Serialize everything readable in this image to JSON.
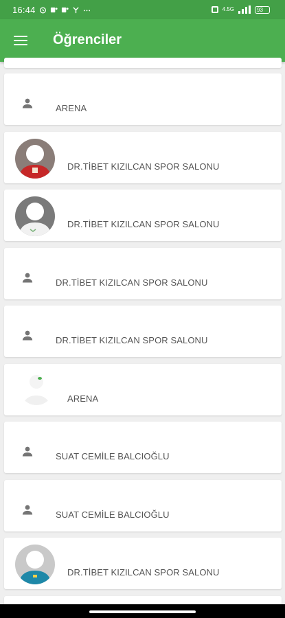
{
  "status_bar": {
    "time": "16:44",
    "network": "4.5G",
    "battery": "93"
  },
  "app_bar": {
    "title": "Öğrenciler"
  },
  "students": [
    {
      "gym": "ARENA",
      "avatar": "person-icon"
    },
    {
      "gym": "DR.TİBET KIZILCAN SPOR SALONU",
      "avatar": "photo-red"
    },
    {
      "gym": "DR.TİBET KIZILCAN SPOR SALONU",
      "avatar": "photo-grey"
    },
    {
      "gym": "DR.TİBET KIZILCAN SPOR SALONU",
      "avatar": "person-icon"
    },
    {
      "gym": "DR.TİBET KIZILCAN SPOR SALONU",
      "avatar": "person-icon"
    },
    {
      "gym": "ARENA",
      "avatar": "photo-white"
    },
    {
      "gym": "SUAT CEMİLE BALCIOĞLU",
      "avatar": "person-icon"
    },
    {
      "gym": "SUAT CEMİLE BALCIOĞLU",
      "avatar": "person-icon"
    },
    {
      "gym": "DR.TİBET KIZILCAN SPOR SALONU",
      "avatar": "photo-blue"
    }
  ],
  "colors": {
    "app_bar": "#4caf50",
    "status_bar": "#43a047",
    "background": "#efefef"
  }
}
